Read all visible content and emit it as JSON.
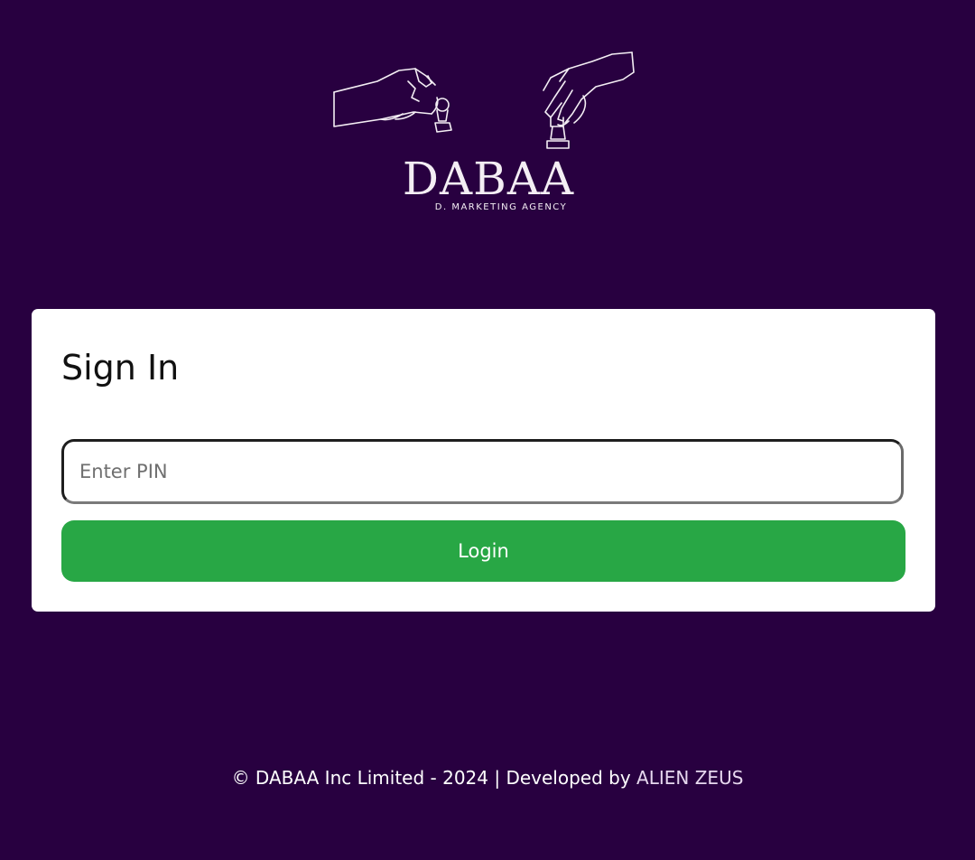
{
  "brand": {
    "name": "DABAA",
    "tagline": "D. MARKETING AGENCY",
    "logo_icon": "chess-hands-icon"
  },
  "signin": {
    "title": "Sign In",
    "pin_placeholder": "Enter PIN",
    "pin_value": "",
    "login_label": "Login"
  },
  "footer": {
    "copyright": "© DABAA Inc Limited - 2024 | Developed by ",
    "developer_link": "ALIEN ZEUS"
  },
  "colors": {
    "background": "#280040",
    "card": "#ffffff",
    "button": "#28a745",
    "text_on_dark": "#ffffff",
    "link": "#e7d8ef"
  }
}
